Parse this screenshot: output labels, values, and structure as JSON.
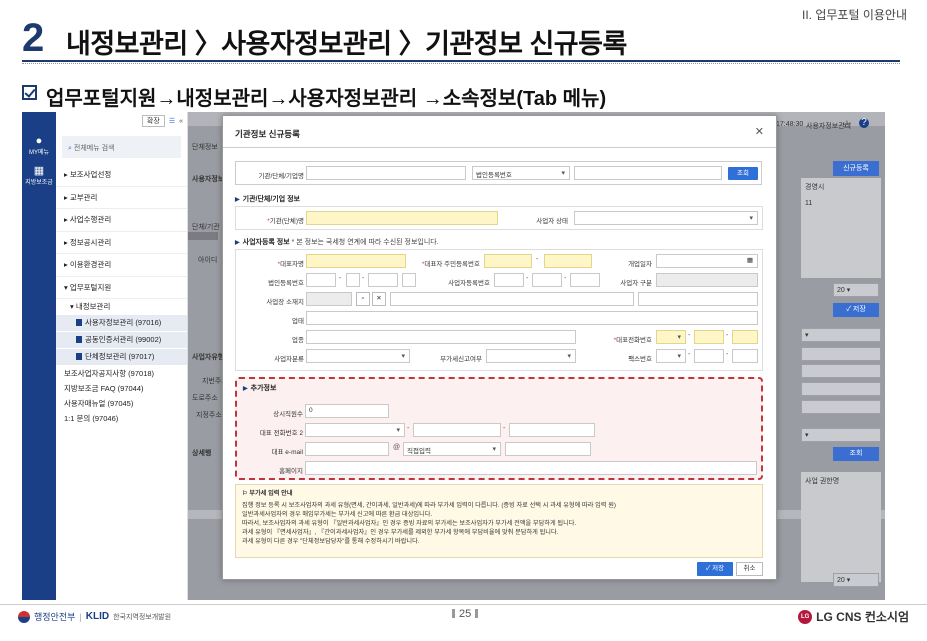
{
  "slide": {
    "section": "II. 업무포털 이용안내",
    "number": "2",
    "title": "내정보관리 〉사용자정보관리 〉기관정보 신규등록",
    "subtitle": "업무포털지원→내정보관리→사용자정보관리 →소속정보(Tab 메뉴)",
    "page": "25"
  },
  "footer": {
    "left_org": "행정안전부",
    "left_klid": "KLID",
    "left_klid_sub": "한국지역정보개발원",
    "right_brand": "LG CNS 컨소시엄"
  },
  "leftbar": {
    "items": [
      {
        "icon": "person-icon",
        "label": "MY메뉴"
      },
      {
        "icon": "building-icon",
        "label": "지방보조금"
      }
    ]
  },
  "menu": {
    "expand_label": "확장",
    "search_placeholder": "전체메뉴 검색",
    "items": [
      "보조사업선정",
      "교부관리",
      "사업수행관리",
      "정보공시관리",
      "이용환경관리",
      "업무포털지원"
    ],
    "sub_parent": "내정보관리",
    "leaves": [
      "사용자정보관리 (97016)",
      "공동인증서관리 (99002)",
      "단체정보관리 (97017)"
    ],
    "plain": [
      "보조사업자공지사항 (97018)",
      "지방보조금 FAQ (97044)",
      "사용자매뉴얼 (97045)",
      "1:1 문의 (97046)"
    ]
  },
  "background": {
    "time": "17:48:30",
    "user_info": "사용자정보관리",
    "new_reg": "신규등록",
    "col_manager": "경영시",
    "col_num": "11",
    "page_size": "20",
    "save": "저장",
    "search": "조회",
    "perm": "사업 권한명",
    "page_size_bottom": "20",
    "left_labels": [
      "단체정보",
      "사용자정보",
      "단체/기관",
      "아이디",
      "사업자유형",
      "지번주소",
      "도로주소",
      "지정주소",
      "상세행"
    ]
  },
  "modal": {
    "title": "기관정보 신규등록",
    "search": {
      "name_label": "기관/단체/기업명",
      "type_value": "법인등록번호",
      "search_button": "조회"
    },
    "section1": "기관/단체/기업 정보",
    "org_name_label": "기관(단체)명",
    "biz_status_label": "사업자 상태",
    "section2": "사업자등록 정보",
    "section2_note": "* 본 정보는 국세청 연계에 따라 수신된 정보입니다.",
    "rep_name_label": "대표자명",
    "rep_id_label": "대표자 주민등록번호",
    "open_date_label": "개업일자",
    "corp_num_label": "법인등록번호",
    "biz_num_label": "사업자등록번호",
    "biz_type_label": "사업자 구분",
    "addr_label": "사업장 소재지",
    "business_label": "업태",
    "item_label": "업종",
    "rep_phone_label": "대표전화번호",
    "biz_kind_label": "사업자분류",
    "vat_label": "부가세신고여부",
    "fax_label": "팩스번호",
    "section3": "추가정보",
    "staff_label": "상시직원수",
    "staff_value": "0",
    "phone2_label": "대표 전화번호 2",
    "email_label": "대표 e-mail",
    "email_at": "@",
    "email_select": "직접입력",
    "homepage_label": "홈페이지",
    "notice_title": "부가세 입력 안내",
    "notice_lines": [
      "집행 정보 등록 시 보조사업자의 과세 유형(면세, 간이과세, 일반과세)에 따라 부가세 입력이 다릅니다. (증빙 자료 선택 시 과세 유형에 따라 입력 원)",
      "일반과세사업자의 경우 매입부가세는 부가세 신고에 따른 환급 대상입니다.",
      "따라서, 보조사업자의 과세 유형이 『일반과세사업자』인 경우 증빙 자료의 부가세는 보조사업자가 부가세 전액을 부담하게 됩니다.",
      "과세 유형이 『면세사업자』, 『간이과세사업자』인 경우 부가세를 제외한 부가세 항목에 부담비율에 맞춰 분담하게 됩니다.",
      "과세 유형이 다른 경우 \"단체정보담당자\"를 통해 수정하시기 바랍니다."
    ],
    "save_button": "저장",
    "cancel_button": "취소"
  }
}
